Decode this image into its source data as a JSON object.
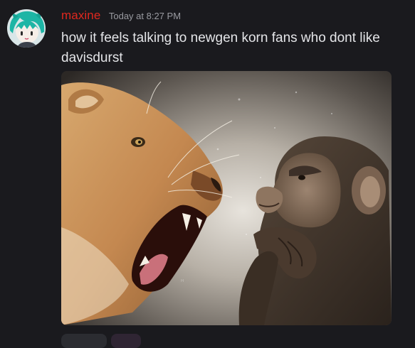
{
  "message": {
    "author": "maxine",
    "timestamp": "Today at 8:27 PM",
    "text": "how it feels talking to newgen korn fans who dont like davisdurst",
    "author_color": "#e0281e"
  },
  "attachment": {
    "type": "image",
    "subject": "lioness-roaring-at-chimpanzee"
  },
  "icons": {
    "avatar": "teal-haired-anime-avatar"
  }
}
